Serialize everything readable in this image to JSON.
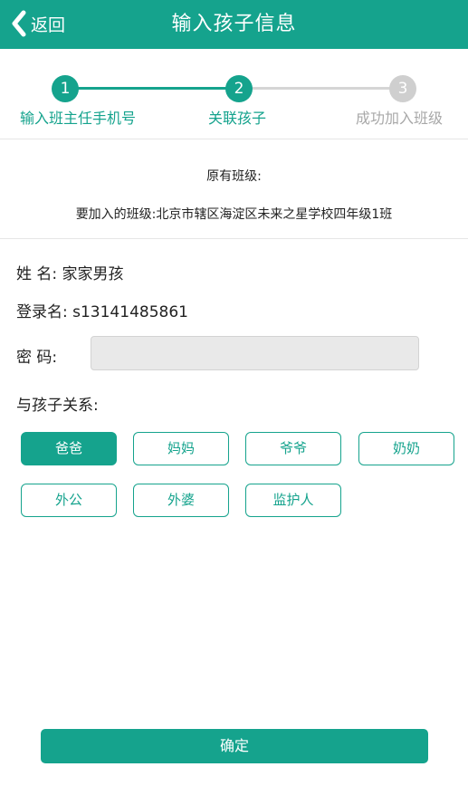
{
  "header": {
    "back_label": "返回",
    "title": "输入孩子信息",
    "back_icon": "chevron-left-icon",
    "color": "#15a38d"
  },
  "steps": {
    "items": [
      {
        "number": "1",
        "label": "输入班主任手机号",
        "state": "done"
      },
      {
        "number": "2",
        "label": "关联孩子",
        "state": "active"
      },
      {
        "number": "3",
        "label": "成功加入班级",
        "state": "pending"
      }
    ],
    "active_color": "#15a38d",
    "inactive_color": "#cfcfcf"
  },
  "class_info": {
    "original": "原有班级:",
    "target": "要加入的班级:北京市辖区海淀区未来之星学校四年级1班"
  },
  "form": {
    "name": "姓  名: 家家男孩",
    "login": "登录名: s13141485861",
    "password_label": "密  码:",
    "password_value": "",
    "relation_label": "与孩子关系:",
    "relations": [
      {
        "label": "爸爸",
        "selected": true
      },
      {
        "label": "妈妈",
        "selected": false
      },
      {
        "label": "爷爷",
        "selected": false
      },
      {
        "label": "奶奶",
        "selected": false
      },
      {
        "label": "外公",
        "selected": false
      },
      {
        "label": "外婆",
        "selected": false
      },
      {
        "label": "监护人",
        "selected": false
      }
    ]
  },
  "confirm_label": "确定"
}
